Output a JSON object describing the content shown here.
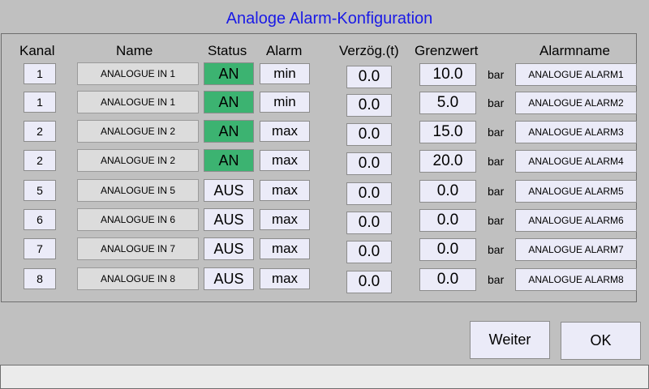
{
  "title": "Analoge Alarm-Konfiguration",
  "headers": {
    "kanal": "Kanal",
    "name": "Name",
    "status": "Status",
    "alarm": "Alarm",
    "delay": "Verzög.(t)",
    "limit": "Grenzwert",
    "alarmname": "Alarmname"
  },
  "rows": [
    {
      "kanal": "1",
      "name": "ANALOGUE  IN 1",
      "status": "AN",
      "alarm": "min",
      "delay": "0.0",
      "limit": "10.0",
      "unit": "bar",
      "alarmname": "ANALOGUE ALARM1"
    },
    {
      "kanal": "1",
      "name": "ANALOGUE  IN 1",
      "status": "AN",
      "alarm": "min",
      "delay": "0.0",
      "limit": "5.0",
      "unit": "bar",
      "alarmname": "ANALOGUE ALARM2"
    },
    {
      "kanal": "2",
      "name": "ANALOGUE IN 2",
      "status": "AN",
      "alarm": "max",
      "delay": "0.0",
      "limit": "15.0",
      "unit": "bar",
      "alarmname": "ANALOGUE ALARM3"
    },
    {
      "kanal": "2",
      "name": "ANALOGUE IN 2",
      "status": "AN",
      "alarm": "max",
      "delay": "0.0",
      "limit": "20.0",
      "unit": "bar",
      "alarmname": "ANALOGUE ALARM4"
    },
    {
      "kanal": "5",
      "name": "ANALOGUE IN 5",
      "status": "AUS",
      "alarm": "max",
      "delay": "0.0",
      "limit": "0.0",
      "unit": "bar",
      "alarmname": "ANALOGUE ALARM5"
    },
    {
      "kanal": "6",
      "name": "ANALOGUE IN 6",
      "status": "AUS",
      "alarm": "max",
      "delay": "0.0",
      "limit": "0.0",
      "unit": "bar",
      "alarmname": "ANALOGUE ALARM6"
    },
    {
      "kanal": "7",
      "name": "ANALOGUE IN 7",
      "status": "AUS",
      "alarm": "max",
      "delay": "0.0",
      "limit": "0.0",
      "unit": "bar",
      "alarmname": "ANALOGUE ALARM7"
    },
    {
      "kanal": "8",
      "name": "ANALOGUE IN 8",
      "status": "AUS",
      "alarm": "max",
      "delay": "0.0",
      "limit": "0.0",
      "unit": "bar",
      "alarmname": "ANALOGUE ALARM8"
    }
  ],
  "buttons": {
    "next": "Weiter",
    "ok": "OK"
  },
  "colors": {
    "title": "#1a1ae6",
    "status_on": "#3cb371",
    "field": "#ebebf8"
  }
}
